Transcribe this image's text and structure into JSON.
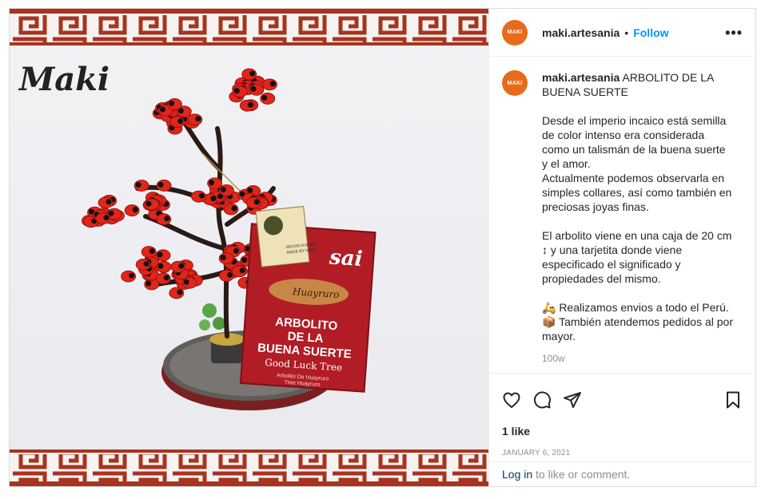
{
  "post": {
    "username": "maki.artesania",
    "avatar_text": "MAKI",
    "separator": "•",
    "follow_label": "Follow",
    "more_label": "•••",
    "brand_watermark": "Maki",
    "caption_title": "ARBOLITO DE LA BUENA SUERTE",
    "caption_text": "Desde el imperio incaico está semilla de color intenso era considerada como un talismán de la buena suerte y el amor.\nActualmente podemos observarla en simples collares, así como también en preciosas joyas finas.\n\nEl arbolito viene en una caja de 20 cm ↕ y una tarjetita donde viene especificado el significado y propiedades del mismo.\n\n🛵 Realizamos envios a todo el Perú.\n📦 También atendemos pedidos al por mayor.",
    "time_ago": "100w",
    "likes": "1 like",
    "date": "JANUARY 6, 2021",
    "login_link": "Log in",
    "login_suffix": " to like or comment."
  },
  "product_label": {
    "hang_tag": "Huayruro",
    "line1": "ARBOLITO",
    "line2": "DE LA",
    "line3": "BUENA SUERTE",
    "subtitle": "Good Luck Tree",
    "small1": "Arbolito De Huayruro",
    "small2": "Tree Huayruro",
    "brand_fragment": "sai",
    "tag_small": "HECHO A MANO",
    "tag_small2": "MADE BY HAND"
  },
  "colors": {
    "accent": "#0095f6",
    "border_band": "#a8341f",
    "seed_red": "#e0251b",
    "avatar": "#e86a1b"
  },
  "icons": [
    "heart-icon",
    "comment-icon",
    "share-icon",
    "bookmark-icon",
    "more-options-icon"
  ]
}
